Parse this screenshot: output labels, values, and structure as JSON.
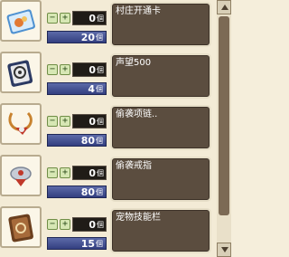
{
  "unit_label": "個",
  "stepper": {
    "minus": "−",
    "plus": "+"
  },
  "items": [
    {
      "name": "村庄开通卡",
      "quantity": "0",
      "stock": "20",
      "icon": "village-card-icon",
      "icon_color": "#5b9fd6"
    },
    {
      "name": "声望500",
      "quantity": "0",
      "stock": "4",
      "icon": "reputation-book-icon",
      "icon_color": "#2f3f6b"
    },
    {
      "name": "偷袭项链..",
      "quantity": "0",
      "stock": "80",
      "icon": "sneak-necklace-icon",
      "icon_color": "#c0392b"
    },
    {
      "name": "偷袭戒指",
      "quantity": "0",
      "stock": "80",
      "icon": "sneak-ring-icon",
      "icon_color": "#b0b7c3"
    },
    {
      "name": "宠物技能栏",
      "quantity": "0",
      "stock": "15",
      "icon": "pet-skill-book-icon",
      "icon_color": "#7a4a26"
    }
  ]
}
